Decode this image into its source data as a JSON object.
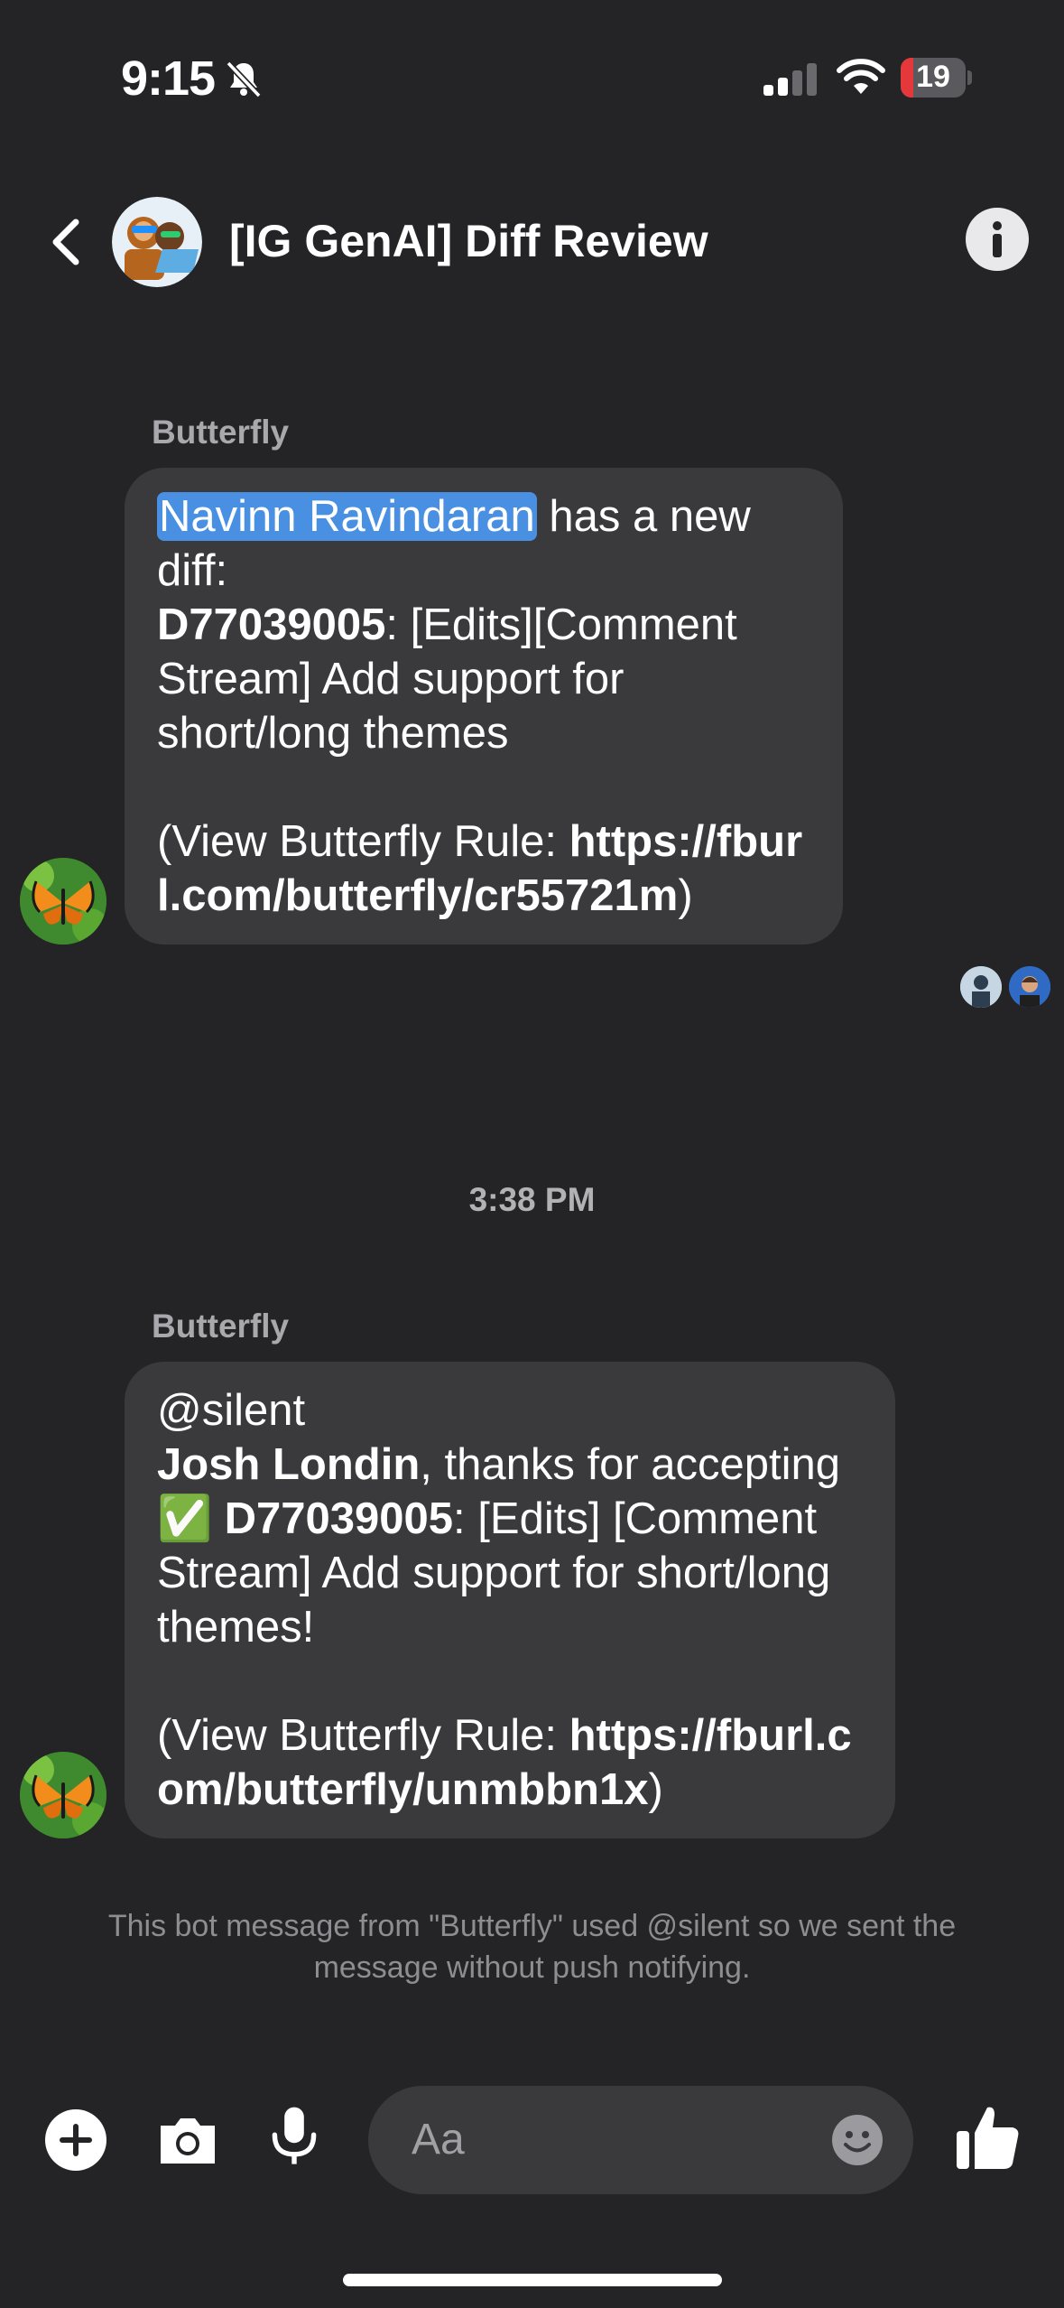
{
  "status_bar": {
    "time": "9:15",
    "battery": "19",
    "battery_level": 0.19
  },
  "header": {
    "title": "[IG GenAI] Diff Review",
    "back_icon": "chevron-left-icon",
    "info_icon": "info-icon"
  },
  "messages": [
    {
      "sender": "Butterfly",
      "mention": "Navinn Ravindaran",
      "text_after_mention": " has a new diff:",
      "diff_id": "D77039005",
      "diff_title": ": [Edits][Comment Stream] Add support for short/long themes",
      "rule_prefix": "(View Butterfly Rule: ",
      "rule_link": "https://fburl.com/butterfly/cr55721m",
      "rule_suffix": ")"
    },
    {
      "sender": "Butterfly",
      "line1": "@silent",
      "person": "Josh Londin",
      "text_after_person": ", thanks for accepting",
      "check_emoji": "✅",
      "diff_id": "D77039005",
      "diff_title": ": [Edits] [Comment Stream] Add support for short/long themes!",
      "rule_prefix": "(View Butterfly Rule: ",
      "rule_link": "https://fburl.com/butterfly/unmbbn1x",
      "rule_suffix": ")"
    }
  ],
  "timestamp": "3:38 PM",
  "notice": "This bot message from \"Butterfly\" used @silent so we sent the message without push notifying.",
  "composer": {
    "placeholder": "Aa"
  },
  "colors": {
    "background": "#242426",
    "bubble": "#3a3a3c",
    "mention_highlight": "#4a90e2"
  }
}
